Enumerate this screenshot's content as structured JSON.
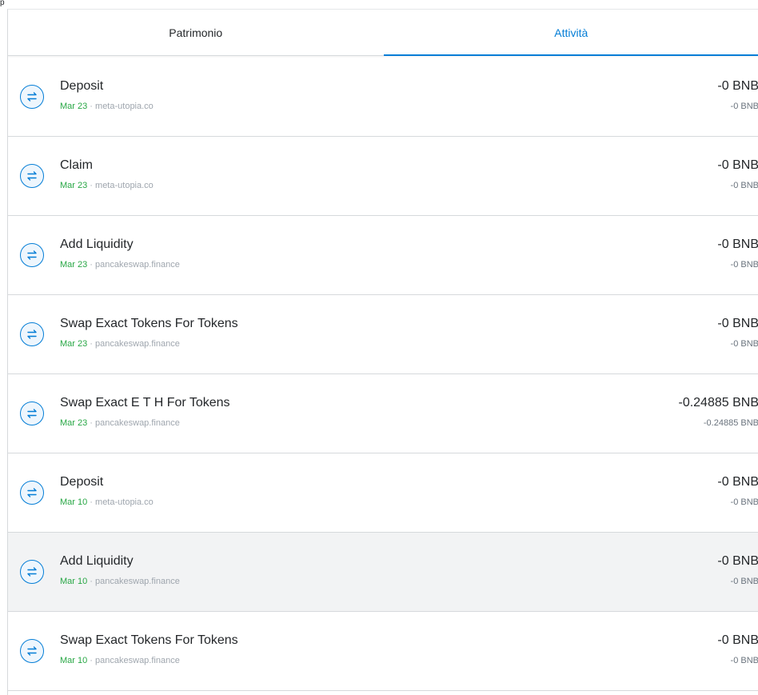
{
  "corner_text": "p",
  "tabs": [
    {
      "label": "Patrimonio",
      "active": false
    },
    {
      "label": "Attività",
      "active": true
    }
  ],
  "colors": {
    "accent": "#037dd6",
    "date_green": "#28a745",
    "muted": "#9fa6ae",
    "row_hover": "#f2f3f4",
    "divider": "#d6d9dc"
  },
  "icon": "swap-arrows-icon",
  "separator": " · ",
  "transactions": [
    {
      "title": "Deposit",
      "date": "Mar 23",
      "origin": "meta-utopia.co",
      "primary": "-0 BNB",
      "secondary": "-0 BNB"
    },
    {
      "title": "Claim",
      "date": "Mar 23",
      "origin": "meta-utopia.co",
      "primary": "-0 BNB",
      "secondary": "-0 BNB"
    },
    {
      "title": "Add Liquidity",
      "date": "Mar 23",
      "origin": "pancakeswap.finance",
      "primary": "-0 BNB",
      "secondary": "-0 BNB"
    },
    {
      "title": "Swap Exact Tokens For Tokens",
      "date": "Mar 23",
      "origin": "pancakeswap.finance",
      "primary": "-0 BNB",
      "secondary": "-0 BNB"
    },
    {
      "title": "Swap Exact E T H For Tokens",
      "date": "Mar 23",
      "origin": "pancakeswap.finance",
      "primary": "-0.24885 BNB",
      "secondary": "-0.24885 BNB"
    },
    {
      "title": "Deposit",
      "date": "Mar 10",
      "origin": "meta-utopia.co",
      "primary": "-0 BNB",
      "secondary": "-0 BNB"
    },
    {
      "title": "Add Liquidity",
      "date": "Mar 10",
      "origin": "pancakeswap.finance",
      "primary": "-0 BNB",
      "secondary": "-0 BNB",
      "hovered": true
    },
    {
      "title": "Swap Exact Tokens For Tokens",
      "date": "Mar 10",
      "origin": "pancakeswap.finance",
      "primary": "-0 BNB",
      "secondary": "-0 BNB"
    }
  ]
}
